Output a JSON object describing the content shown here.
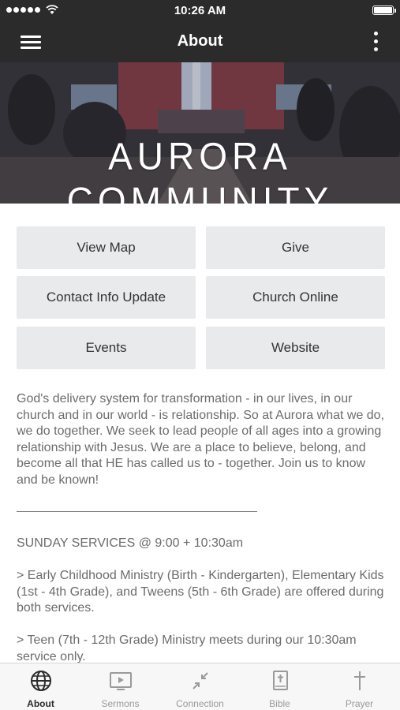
{
  "status_bar": {
    "time": "10:26 AM"
  },
  "header": {
    "title": "About"
  },
  "banner": {
    "brand": "AURORA COMMUNITY"
  },
  "buttons": [
    {
      "label": "View Map"
    },
    {
      "label": "Give"
    },
    {
      "label": "Contact Info Update"
    },
    {
      "label": "Church Online"
    },
    {
      "label": "Events"
    },
    {
      "label": "Website"
    }
  ],
  "content": {
    "intro": "God's delivery system for transformation - in our lives, in our church and in our world - is relationship. So at Aurora what we do, we do together. We seek to lead people of all ages into a growing relationship with Jesus. We are a place to believe, belong, and become all that HE has called us to - together. Join us to know and be known!",
    "services_title": "SUNDAY SERVICES @ 9:00 + 10:30am",
    "children": "> Early Childhood Ministry (Birth - Kindergarten), Elementary Kids (1st - 4th Grade), and Tweens (5th - 6th Grade) are offered during both services.",
    "teen": "> Teen (7th - 12th Grade) Ministry meets during our 10:30am service only."
  },
  "tabs": [
    {
      "label": "About",
      "icon": "globe-icon",
      "active": true
    },
    {
      "label": "Sermons",
      "icon": "video-play-icon",
      "active": false
    },
    {
      "label": "Connection",
      "icon": "arrows-in-icon",
      "active": false
    },
    {
      "label": "Bible",
      "icon": "bible-icon",
      "active": false
    },
    {
      "label": "Prayer",
      "icon": "cross-icon",
      "active": false
    }
  ],
  "colors": {
    "header_bg": "#2b2b2b",
    "button_bg": "#e9eaec",
    "text": "#6c6c6c",
    "tab_active": "#2b2b2b",
    "tab_inactive": "#9a9a9a"
  }
}
